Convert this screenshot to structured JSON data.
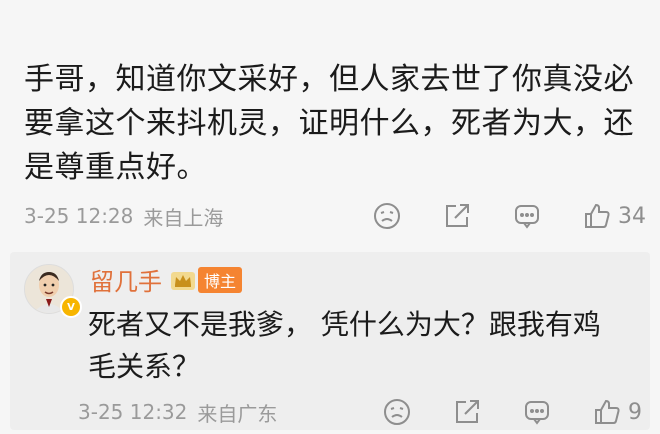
{
  "comment": {
    "text": "手哥，知道你文采好，但人家去世了你真没必要拿这个来抖机灵，证明什么，死者为大，还是尊重点好。",
    "date": "3-25 12:28",
    "location": "来自上海",
    "like_count": "34"
  },
  "reply": {
    "author": "留几手",
    "author_badge": "博主",
    "text": "死者又不是我爹， 凭什么为大？跟我有鸡毛关系？",
    "date": "3-25 12:32",
    "location": "来自广东",
    "like_count": "9"
  },
  "icons": [
    "face-icon",
    "share-icon",
    "comment-icon",
    "thumbs-up-icon"
  ],
  "colors": {
    "author_name": "#e0713b",
    "badge_bg": "#f58431",
    "meta_gray": "#9a9a9a"
  }
}
